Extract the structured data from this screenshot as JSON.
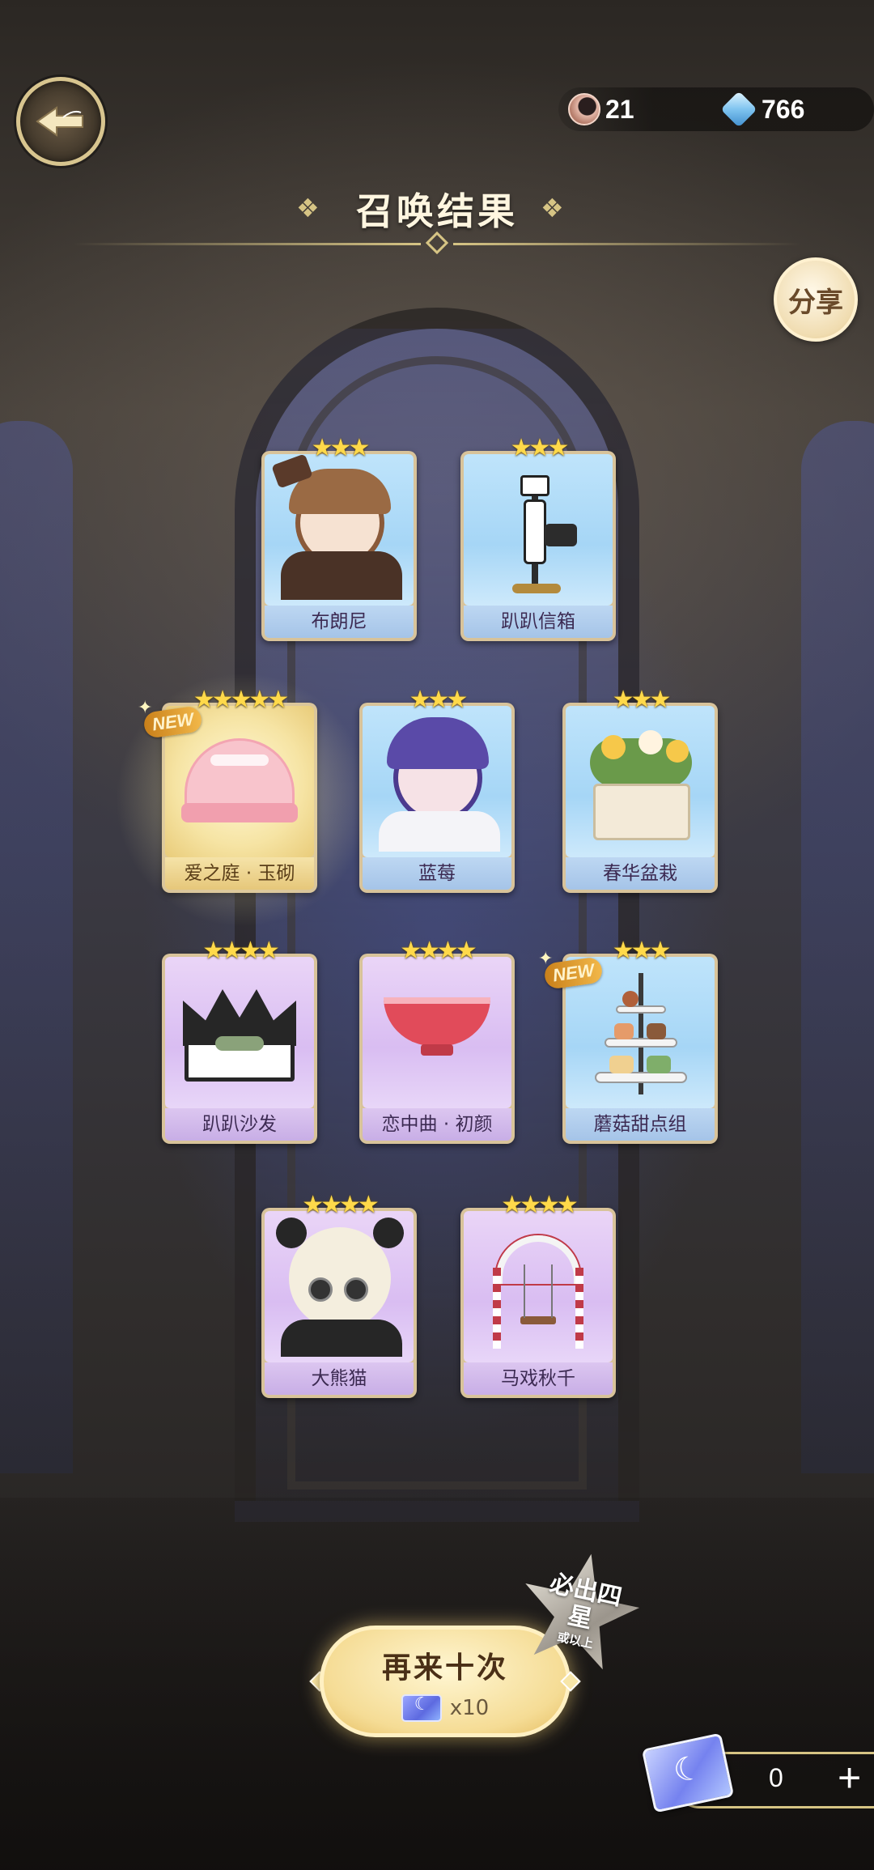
{
  "header": {
    "currencies": [
      {
        "name": "moon-currency",
        "value": "21"
      },
      {
        "name": "gem-currency",
        "value": "766"
      }
    ],
    "title": "召唤结果",
    "share_label": "分享"
  },
  "results": [
    {
      "name": "布朗尼",
      "stars": "★★★",
      "theme": "blue",
      "new": false,
      "icon": "brownie-character-icon"
    },
    {
      "name": "趴趴信箱",
      "stars": "★★★",
      "theme": "blue",
      "new": false,
      "icon": "mailbox-icon"
    },
    {
      "name": "爱之庭 · 玉砌",
      "stars": "★★★★★",
      "theme": "gold",
      "new": true,
      "icon": "pink-canopy-icon"
    },
    {
      "name": "蓝莓",
      "stars": "★★★",
      "theme": "blue",
      "new": false,
      "icon": "blueberry-character-icon"
    },
    {
      "name": "春华盆栽",
      "stars": "★★★",
      "theme": "blue",
      "new": false,
      "icon": "flower-planter-icon"
    },
    {
      "name": "趴趴沙发",
      "stars": "★★★★",
      "theme": "purple",
      "new": false,
      "icon": "crown-sofa-icon"
    },
    {
      "name": "恋中曲 · 初颜",
      "stars": "★★★★",
      "theme": "purple",
      "new": false,
      "icon": "pink-bowl-icon"
    },
    {
      "name": "蘑菇甜点组",
      "stars": "★★★",
      "theme": "blue",
      "new": true,
      "icon": "dessert-stand-icon"
    },
    {
      "name": "大熊猫",
      "stars": "★★★★",
      "theme": "purple",
      "new": false,
      "icon": "panda-character-icon"
    },
    {
      "name": "马戏秋千",
      "stars": "★★★★",
      "theme": "purple",
      "new": false,
      "icon": "circus-swing-icon"
    }
  ],
  "new_label": "NEW",
  "footer": {
    "again_label": "再来十次",
    "cost": "x10",
    "promise_main": "必出四星",
    "promise_sub": "或以上",
    "ticket_count": "0",
    "plus_label": "+"
  },
  "colors": {
    "accent_gold": "#d6c484",
    "star": "#ffd94a"
  }
}
